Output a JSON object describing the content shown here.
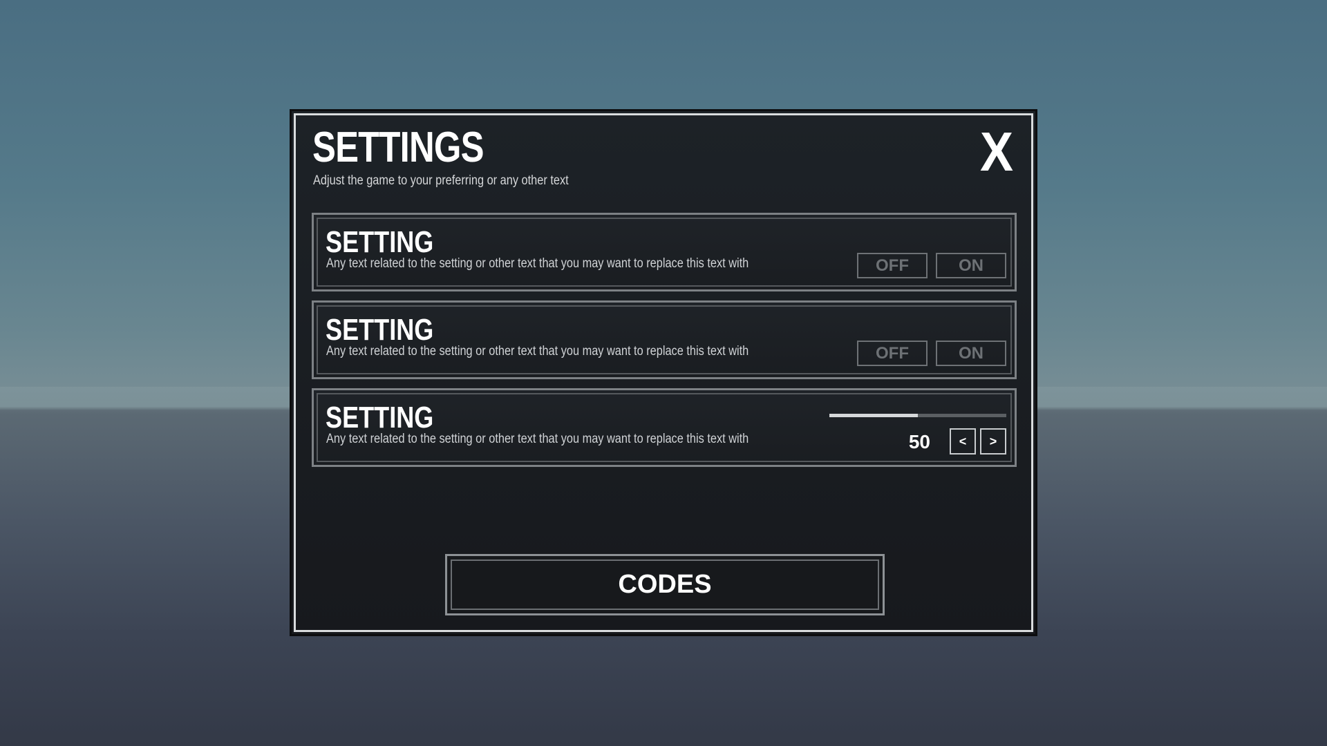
{
  "settings_panel": {
    "title": "SETTINGS",
    "subtitle": "Adjust the game to your preferring or any other text",
    "close_label": "X"
  },
  "settings": [
    {
      "title": "SETTING",
      "description": "Any text related to the setting or other text that you may want to replace this text with",
      "control": "toggle",
      "off_label": "OFF",
      "on_label": "ON"
    },
    {
      "title": "SETTING",
      "description": "Any text related to the setting or other text that you may want to replace this text with",
      "control": "toggle",
      "off_label": "OFF",
      "on_label": "ON"
    },
    {
      "title": "SETTING",
      "description": "Any text related to the setting or other text that you may want to replace this text with",
      "control": "slider",
      "value": "50",
      "level_percent": 50,
      "decrement_label": "<",
      "increment_label": ">"
    }
  ],
  "codes_button": {
    "label": "CODES"
  },
  "colors": {
    "panel_background": "#1a1d21",
    "panel_border": "#d9dcde",
    "text_primary": "#ffffff",
    "toggle_inactive": "#6d7175",
    "slider_fill": "#d6d8da",
    "slider_track": "#5b5f63"
  }
}
